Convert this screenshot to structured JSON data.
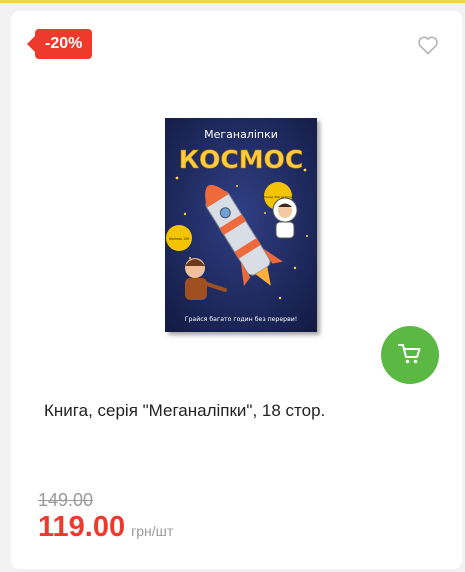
{
  "card": {
    "discount_badge": "-20%",
    "image": {
      "series": "Меганаліпки",
      "title": "КОСМОС",
      "stickers_badge": "Понад 300 наліпок",
      "pages_badge": "Наліпок 159",
      "bottom_text": "Грайся багато годин без перерви!"
    },
    "title": "Книга, серія \"Меганаліпки\", 18 стор.",
    "old_price": "149.00",
    "price": "119.00",
    "unit": "грн/шт"
  },
  "icons": {
    "wishlist": "heart-icon",
    "cart": "cart-icon"
  },
  "colors": {
    "discount": "#ee3a2c",
    "cart": "#5ab843",
    "price": "#ee3a2c",
    "top_line": "#f5d24a"
  }
}
